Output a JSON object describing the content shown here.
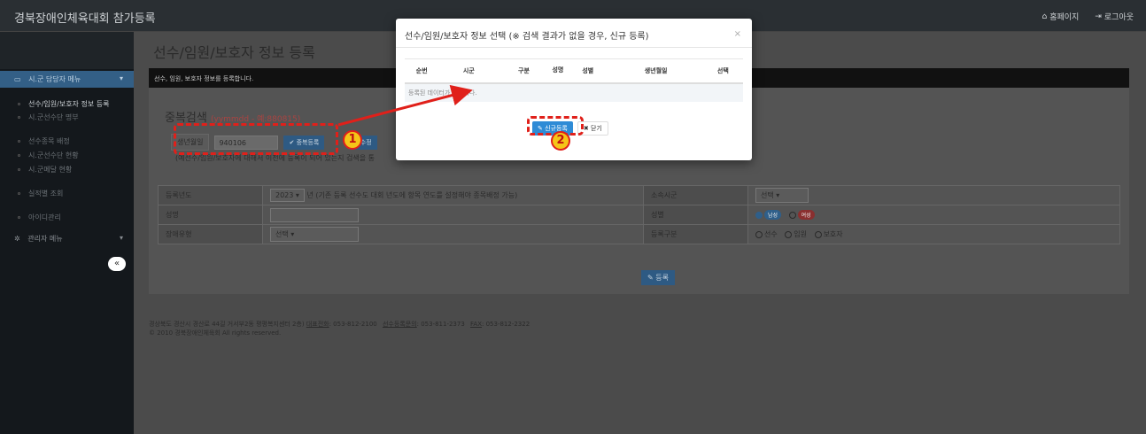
{
  "topbar": {
    "brand": "경북장애인체육대회 참가등록",
    "homepage_label": "홈페이지",
    "logout_label": "로그아웃"
  },
  "sidebar": {
    "sections": [
      {
        "label": "시.군 담당자 메뉴"
      },
      {
        "label": "관리자 메뉴"
      }
    ],
    "items": [
      {
        "label": "선수/임원/보호자 정보 등록",
        "active": true
      },
      {
        "label": "시.군선수단 명부"
      },
      {
        "label": "선수종목 배정"
      },
      {
        "label": "시.군선수단 현황"
      },
      {
        "label": "시.군메달 현황"
      },
      {
        "label": "실적별 조회"
      },
      {
        "label": "아이디관리"
      }
    ],
    "collapse_label": "«"
  },
  "main": {
    "title": "선수/임원/보호자 정보 등록",
    "bar_text": "선수, 임원, 보호자 정보를 등록합니다.",
    "search": {
      "title": "중복검색",
      "hint": "(yymmdd - 예:880815)",
      "label": "생년월일",
      "value": "940106",
      "btn_dup": "중복등록",
      "btn_edit": "보수정",
      "notice": "(예선수/임원/보호자에 대해서 이전에 등록이 되어 있는지 검색을 통"
    },
    "form": {
      "year_label": "등록년도",
      "year_value": "2023",
      "year_note": "년 (기존 등록 선수도 대회 년도에 항목 연도를 설정해야 종목배정 가능)",
      "region_label": "소속시군",
      "region_value": "선택",
      "name_label": "성명",
      "gender_label": "성별",
      "male": "남성",
      "female": "여성",
      "disability_label": "장애유형",
      "disability_value": "선택",
      "type_label": "등록구분",
      "type_options": [
        "선수",
        "임원",
        "보호자"
      ],
      "submit": "등록"
    },
    "footer": {
      "address": "경상북도 경산시 경산로 44길 거서부2동 평평복지센터 2층)",
      "rep_label": "대표전화",
      "rep": ": 053-812-2100",
      "inq_label": "선수등록문의",
      "inq": ": 053-811-2373",
      "fax_label": "FAX",
      "fax": ": 053-812-2322",
      "copyright": "© 2010 경북장애인체육회 All rights reserved."
    }
  },
  "modal": {
    "title": "선수/임원/보호자 정보 선택 (※ 검색 결과가 없을 경우, 신규 등록)",
    "close": "×",
    "columns": [
      "순번",
      "시군",
      "구분",
      "성명",
      "성별",
      "생년월일",
      "선택"
    ],
    "empty": "등록된 데이터가 없습니다.",
    "new_btn": "신규등록",
    "close_btn": "닫기"
  },
  "annotations": [
    "1",
    "2"
  ],
  "colors": {
    "accent": "#2e8bd6",
    "annot": "#e0201a",
    "badge": "#f5c518"
  }
}
